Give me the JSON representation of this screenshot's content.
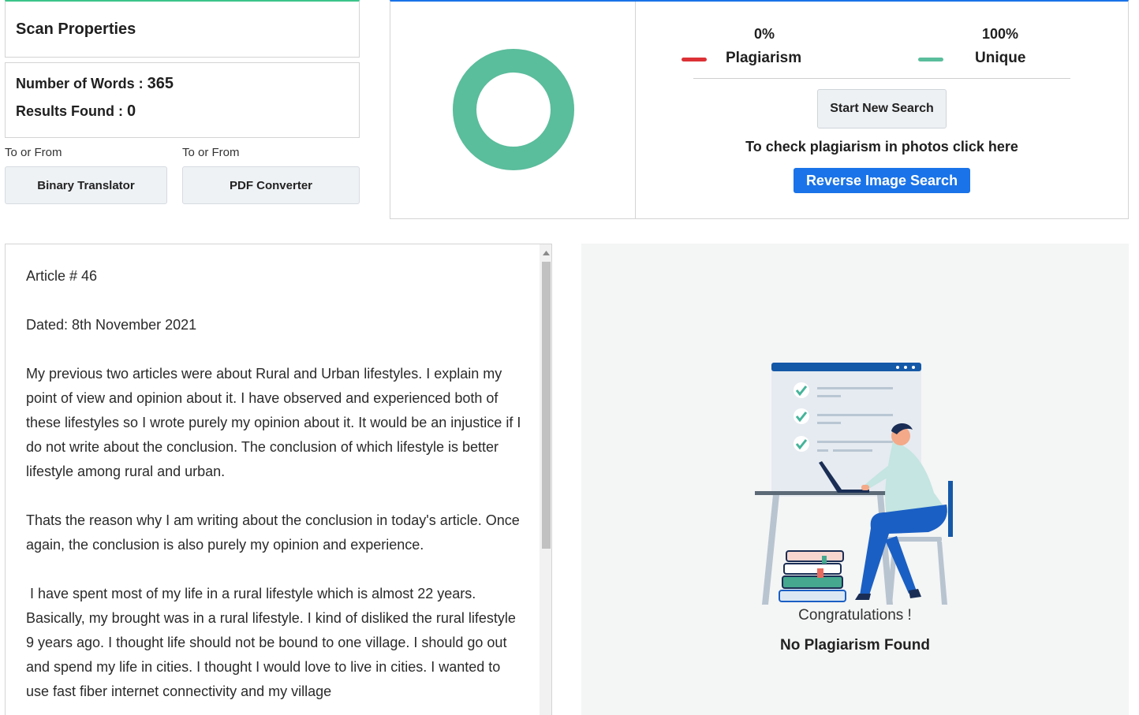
{
  "scan": {
    "title": "Scan Properties",
    "words_label": "Number of Words : ",
    "words_value": "365",
    "results_label": "Results Found : ",
    "results_value": "0"
  },
  "tools": [
    {
      "caption": "To or From",
      "label": "Binary Translator"
    },
    {
      "caption": "To or From",
      "label": "PDF Converter"
    }
  ],
  "result": {
    "plagiarism_pct": "0%",
    "plagiarism_label": "Plagiarism",
    "unique_pct": "100%",
    "unique_label": "Unique",
    "start_button": "Start New Search",
    "photo_text": "To check plagiarism in photos click here",
    "reverse_button": "Reverse Image Search",
    "unique_fraction": 1.0
  },
  "article": {
    "paragraphs": [
      "Article # 46",
      "Dated: 8th November 2021",
      "My previous two articles were about Rural and Urban lifestyles. I explain my point of view and opinion about it. I have observed and experienced both of these lifestyles so I wrote purely my opinion about it. It would be an injustice if I do not write about the conclusion. The conclusion of which lifestyle is better lifestyle among rural and urban.",
      "Thats the reason why I am writing about the conclusion in today's article. Once again, the conclusion is also purely my opinion and experience.",
      " I have spent most of my life in a rural lifestyle which is almost 22 years. Basically, my brought was in a rural lifestyle. I kind of disliked the rural lifestyle 9 years ago. I thought life should not be bound to one village. I should go out and spend my life in cities. I thought I would love to live in cities. I wanted to use fast fiber internet connectivity and my village"
    ]
  },
  "congrats": {
    "title": "Congratulations !",
    "message": "No Plagiarism Found"
  },
  "colors": {
    "plagiarism": "#dc3136",
    "unique": "#5abd9c",
    "accent_blue": "#1a73e8",
    "accent_green": "#3cc48a"
  }
}
